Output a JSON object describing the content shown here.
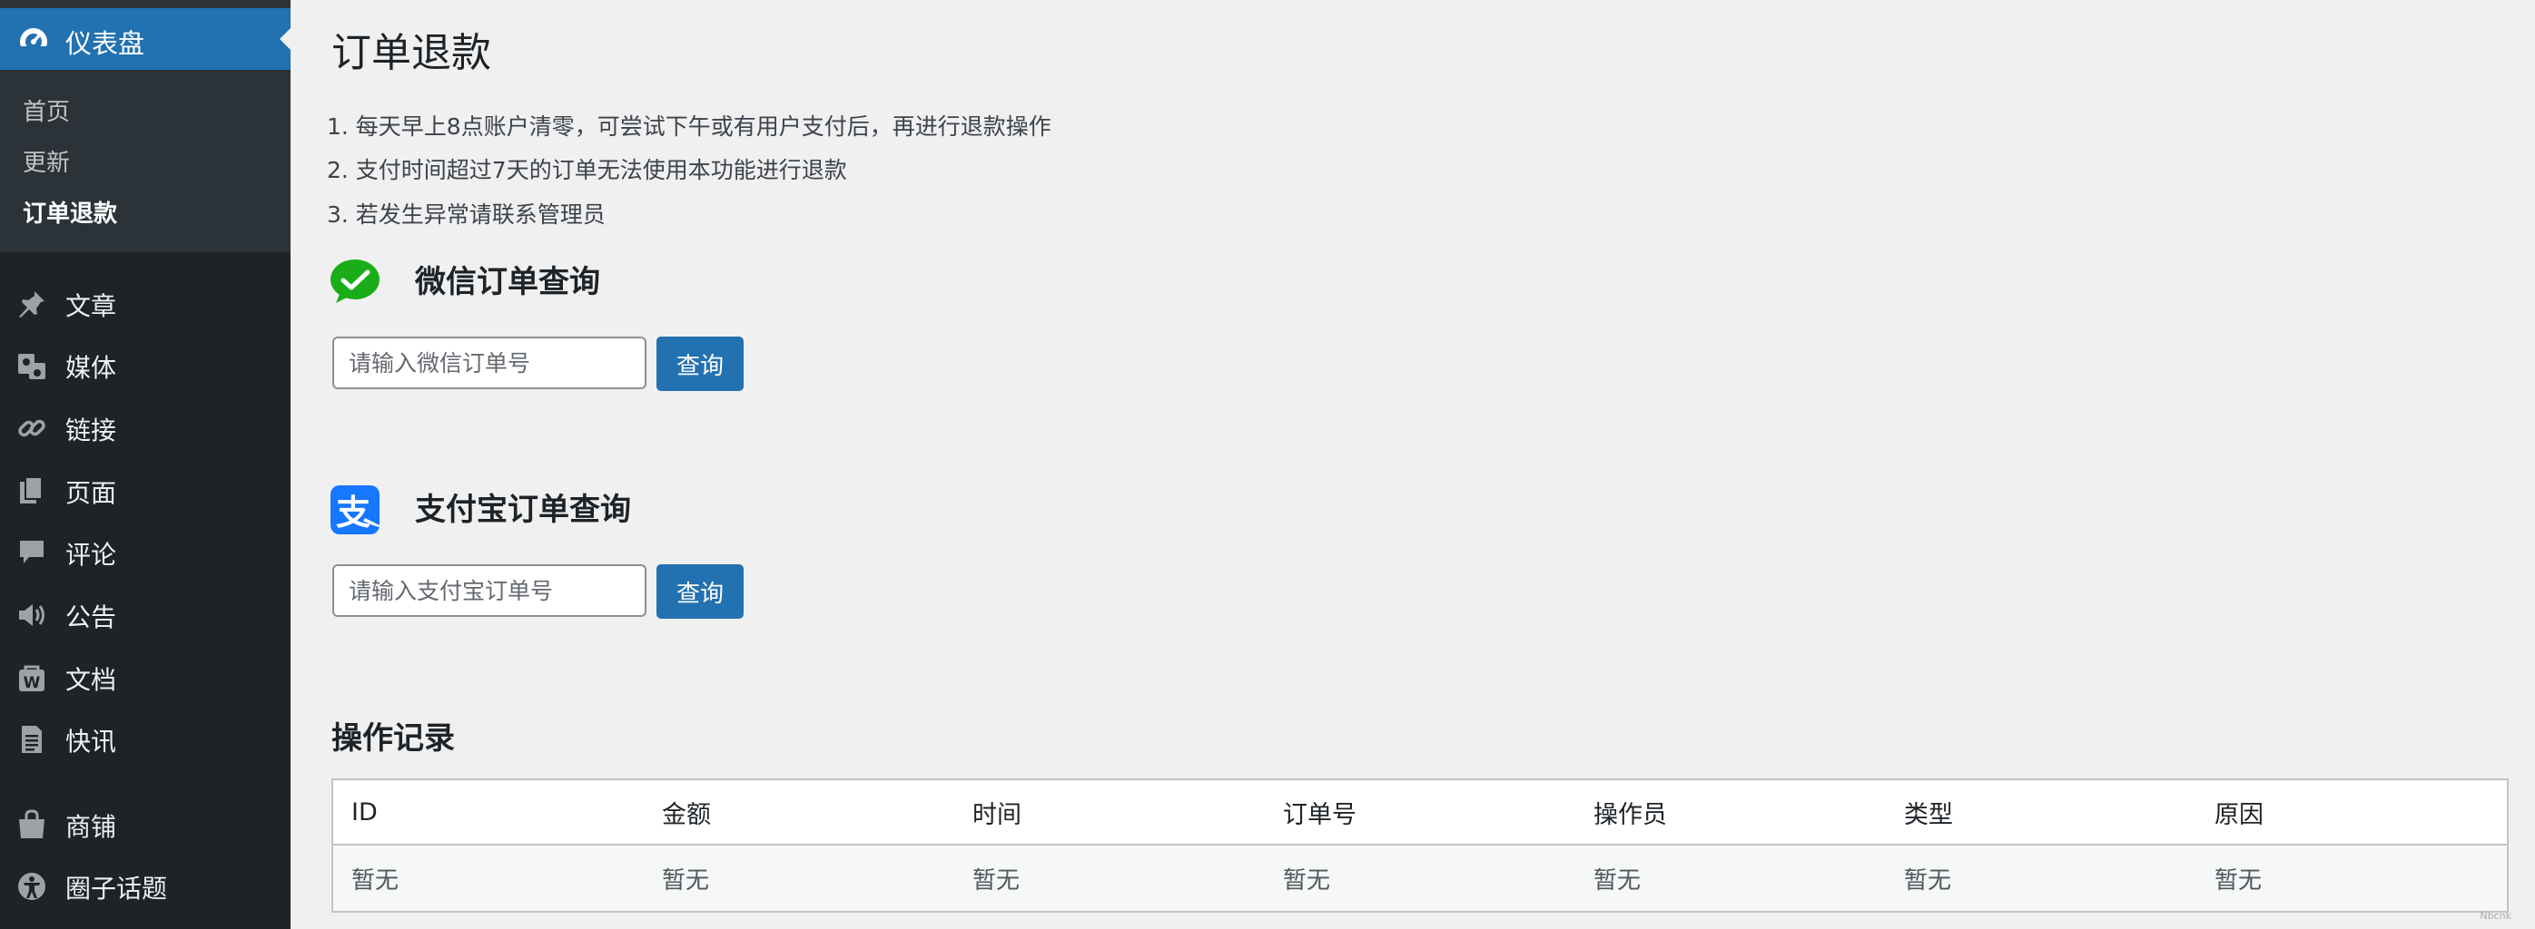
{
  "sidebar": {
    "active_label": "仪表盘",
    "submenu": [
      "首页",
      "更新",
      "订单退款"
    ],
    "items": [
      {
        "label": "文章",
        "icon": "pin-icon"
      },
      {
        "label": "媒体",
        "icon": "media-icon"
      },
      {
        "label": "链接",
        "icon": "link-icon"
      },
      {
        "label": "页面",
        "icon": "pages-icon"
      },
      {
        "label": "评论",
        "icon": "comment-icon"
      },
      {
        "label": "公告",
        "icon": "megaphone-icon"
      },
      {
        "label": "文档",
        "icon": "document-icon"
      },
      {
        "label": "快讯",
        "icon": "news-icon"
      },
      {
        "label": "商铺",
        "icon": "store-icon"
      },
      {
        "label": "圈子话题",
        "icon": "community-icon"
      }
    ]
  },
  "page": {
    "title": "订单退款",
    "notes": [
      "1. 每天早上8点账户清零，可尝试下午或有用户支付后，再进行退款操作",
      "2. 支付时间超过7天的订单无法使用本功能进行退款",
      "3. 若发生异常请联系管理员"
    ]
  },
  "wechat": {
    "title": "微信订单查询",
    "placeholder": "请输入微信订单号",
    "button": "查询",
    "icon": "wechat-icon",
    "color": "#1aad19"
  },
  "alipay": {
    "title": "支付宝订单查询",
    "placeholder": "请输入支付宝订单号",
    "button": "查询",
    "icon": "alipay-icon",
    "color": "#1677ff"
  },
  "log": {
    "title": "操作记录",
    "columns": [
      "ID",
      "金额",
      "时间",
      "订单号",
      "操作员",
      "类型",
      "原因"
    ],
    "rows": [
      [
        "暂无",
        "暂无",
        "暂无",
        "暂无",
        "暂无",
        "暂无",
        "暂无"
      ]
    ]
  },
  "watermark": "Nbcnk",
  "colors": {
    "accent": "#2271b1",
    "sidebar": "#1d2327",
    "submenu": "#2c3338"
  }
}
